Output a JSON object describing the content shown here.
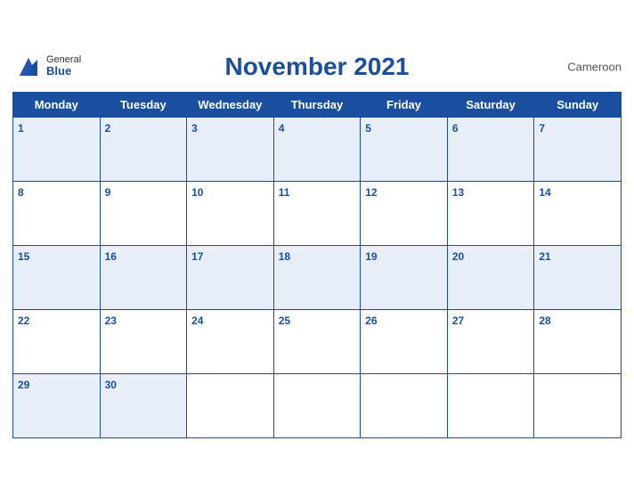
{
  "header": {
    "logo_general": "General",
    "logo_blue": "Blue",
    "month_year": "November 2021",
    "country": "Cameroon"
  },
  "weekdays": [
    "Monday",
    "Tuesday",
    "Wednesday",
    "Thursday",
    "Friday",
    "Saturday",
    "Sunday"
  ],
  "weeks": [
    [
      1,
      2,
      3,
      4,
      5,
      6,
      7
    ],
    [
      8,
      9,
      10,
      11,
      12,
      13,
      14
    ],
    [
      15,
      16,
      17,
      18,
      19,
      20,
      21
    ],
    [
      22,
      23,
      24,
      25,
      26,
      27,
      28
    ],
    [
      29,
      30,
      null,
      null,
      null,
      null,
      null
    ]
  ]
}
